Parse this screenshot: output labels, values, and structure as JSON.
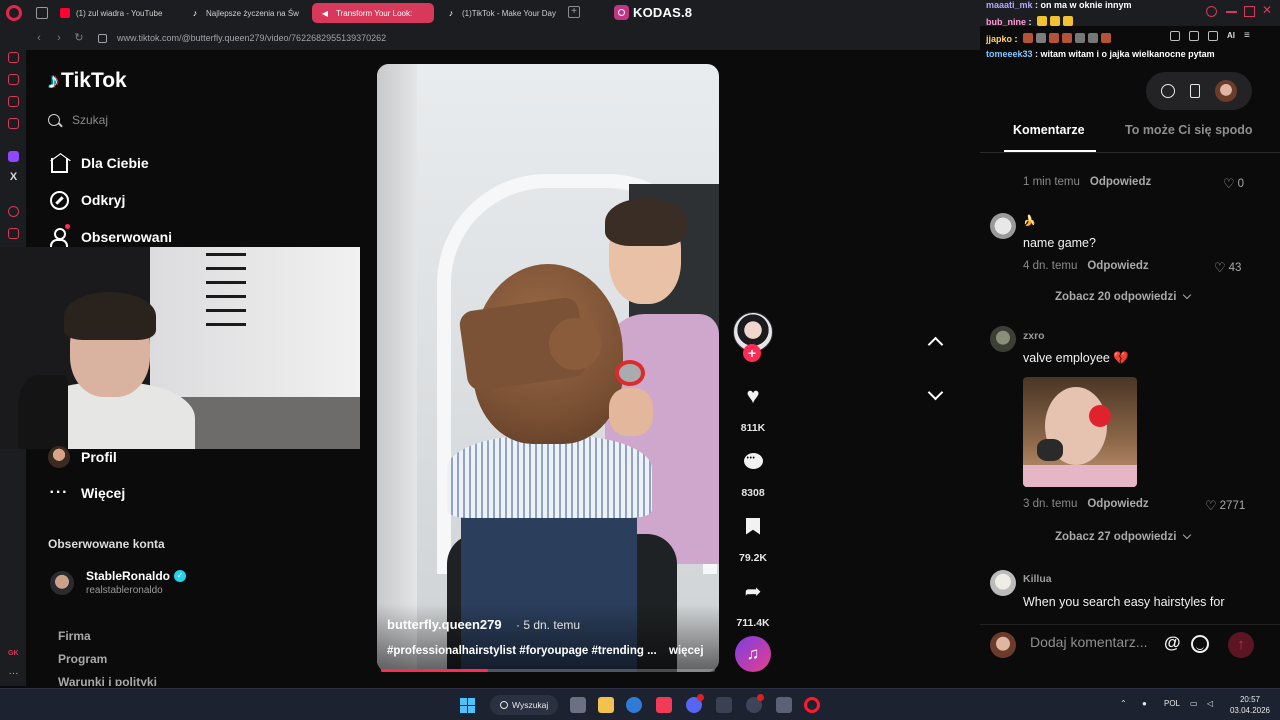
{
  "browser": {
    "tabs": [
      {
        "label": "(1) zul wiadra - YouTube",
        "icon": "youtube-icon",
        "active": false
      },
      {
        "label": "Najlepsze życzenia na Św",
        "icon": "tiktok-icon",
        "active": false
      },
      {
        "label": "Transform Your Look:",
        "icon": "speaker-icon",
        "active": true
      },
      {
        "label": "(1)TikTok - Make Your Day",
        "icon": "tiktok-icon",
        "active": false
      }
    ],
    "url": "www.tiktok.com/@butterfly.queen279/video/7622682955139370262",
    "ai_label": "AI"
  },
  "stream_overlay": {
    "instagram_handle": "KODAS.8",
    "chat": [
      {
        "user": "maaati_mk",
        "message": "on ma w oknie innym"
      },
      {
        "user": "bub_nine",
        "message": ""
      },
      {
        "user": "jjapko",
        "message": ""
      },
      {
        "user": "tomeeek33",
        "message": "witam witam i o jajka wielkanocne pytam"
      }
    ]
  },
  "tiktok": {
    "logo": "TikTok",
    "search_placeholder": "Szukaj",
    "nav": {
      "for_you": "Dla Ciebie",
      "explore": "Odkryj",
      "following": "Obserwowani",
      "profile": "Profil",
      "more": "Więcej"
    },
    "followed_accounts_heading": "Obserwowane konta",
    "followed_accounts": [
      {
        "name": "StableRonaldo",
        "handle": "realstableronaldo",
        "verified": true
      }
    ],
    "footer_links": [
      "Firma",
      "Program",
      "Warunki i polityki"
    ]
  },
  "video": {
    "author": "butterfly.queen279",
    "time_ago": "· 5 dn. temu",
    "description": "#professionalhairstylist #foryoupage #trending ...",
    "more_label": "więcej",
    "progress_pct": 32,
    "likes": "811K",
    "comments": "8308",
    "saves": "79.2K",
    "shares": "711.4K",
    "follow_plus": "+",
    "music_glyph": "♫"
  },
  "comments_panel": {
    "tabs": {
      "comments": "Komentarze",
      "you_may_like": "To może Ci się spodo"
    },
    "reply_label": "Odpowiedz",
    "top_partial": {
      "time": "1 min temu",
      "likes": "0"
    },
    "items": [
      {
        "user": "🍌",
        "text": "name game?",
        "time": "4 dn. temu",
        "likes": "43",
        "replies": "Zobacz 20 odpowiedzi"
      },
      {
        "user": "zxro",
        "text": "valve employee 💔",
        "time": "3 dn. temu",
        "likes": "2771",
        "replies": "Zobacz 27 odpowiedzi"
      },
      {
        "user": "Killua",
        "text": "When you search easy hairstyles for"
      }
    ],
    "add_placeholder": "Dodaj komentarz...",
    "at_symbol": "@",
    "send_glyph": "↑"
  },
  "taskbar": {
    "search_label": "Wyszukaj",
    "language": "POL",
    "time": "20:57",
    "date": "03.04.2026"
  }
}
